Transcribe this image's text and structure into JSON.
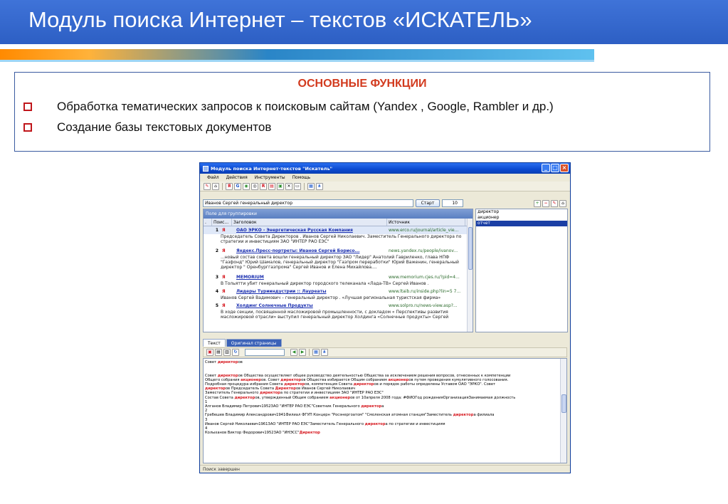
{
  "slide": {
    "title": "Модуль поиска Интернет – текстов «ИСКАТЕЛЬ»",
    "functions_heading": "ОСНОВНЫЕ ФУНКЦИИ",
    "functions": [
      "Обработка тематических запросов к поисковым сайтам (Yandex , Google, Rambler и др.)",
      "Создание базы текстовых документов"
    ]
  },
  "window": {
    "title": "Модуль поиска Интернет-текстов \"Искатель\"",
    "menu": [
      "Файл",
      "Действия",
      "Инструменты",
      "Помощь"
    ],
    "query": "Иванов Сергей генеральный директор",
    "start_label": "Старт",
    "result_count": "10",
    "group_hint": "Поле для группировки",
    "columns": {
      "dot": ".",
      "engine": "Поис...",
      "title": "Заголовок",
      "source": "Источник"
    },
    "results": [
      {
        "num": "1",
        "engine": "Я",
        "title": "ОАО ЭРКО - Энергетическая Русская Компания",
        "source": "www.erco.ru/journal/article_vie...",
        "snippet": "Председатель Совета Директоров . Иванов Сергей Николаевич. Заместитель Генерального директора по стратегии и инвестициям ЗАО \"ИНТЕР РАО ЕЭС\""
      },
      {
        "num": "2",
        "engine": "Я",
        "title": "Яндекс.Пресс-портреты: Иванов Сергей Борисо...",
        "source": "news.yandex.ru/people/ivanov...",
        "snippet": "...новый состав совета вошли генеральный директор ЗАО \"Лидер\" Анатолий Гавриленко, глава НПФ \"Газфонд\" Юрий Шамалов, генеральный директор \"Газпром переработки\" Юрий Важенин, генеральный директор \" Оренбурггазпрома\" Сергей Иванов и Елена Михайлова...."
      },
      {
        "num": "3",
        "engine": "Я",
        "title": "MEMORIUM",
        "source": "www.memorium.cjes.ru/?pid=4...",
        "snippet": "В Тольятти убит генеральный директор городского телеканала «Лада-ТВ» Сергей Иванов ."
      },
      {
        "num": "4",
        "engine": "Я",
        "title": "Лидеры Турииндустрии :: Лауреаты",
        "source": "www.ltaib.ru/inside.php?lin=5 7...",
        "snippet": "Иванов Сергей Вадимович – генеральный директор . «Лучшая региональная туристская фирма»"
      },
      {
        "num": "5",
        "engine": "Я",
        "title": "Холдинг Солнечные Продукты",
        "source": "www.solpro.ru/news-view.asp?...",
        "snippet": "В ходе секции, посвященной масложировой промышленности, с докладом « Перспективы развития масложировой отрасли» выступил генеральный директор Холдинга «Солнечные продукты» Сергей"
      }
    ],
    "side_list": [
      "директор",
      "акционер",
      "отчет"
    ],
    "tabs": [
      "Текст",
      "Оригинал страницы"
    ],
    "text_lines": [
      "Совет директоров",
      "",
      "",
      "Совет директоров Общества осуществляет общее руководство деятельностью Общества за исключением решения вопросов, отнесенных к компетенции",
      "Общего собрания акционеров. Совет директоров Общества избирается Общим собранием акционеров путем проведения кумулятивного голосования.",
      "Подробная процедура избрания Совета директоров, компетенция Совета директоров и порядок работы определены Уставом ОАО \"ЭРКО\". Совет",
      "директоров Председатель Совета Директоров Иванов Сергей Николаевич",
      "Заместитель Генерального директора по стратегии и инвестициям ЗАО \"ИНТЕР РАО ЕЭС\"",
      "Состав Совета директоров, утвержденный Общим собранием акционеров от 10апреля 2008 года: #ФИОГод рожденияОрганизацияЗанимаемая должность",
      "1",
      "Алганов Владимир Петрович19523АО \"ИНТЕР РАО ЕЭС\"Советник Генерального директора",
      "2",
      "Гребешев Владимир Александрович1941Филиал ФГУП Концерн \"Росэнергоатом\" \"Смоленская атомная станция\"Заместитель директора филиала",
      "3",
      "Иванов Сергей Николаевич19613АО \"ИНТЕР РАО ЕЭС\"Заместитель Генерального директора по стратегии и инвестициям",
      "4",
      "Колыханов Виктор Федорович19523АО \"ИНЭСС\"Директор"
    ],
    "status": "Поиск завершен"
  }
}
